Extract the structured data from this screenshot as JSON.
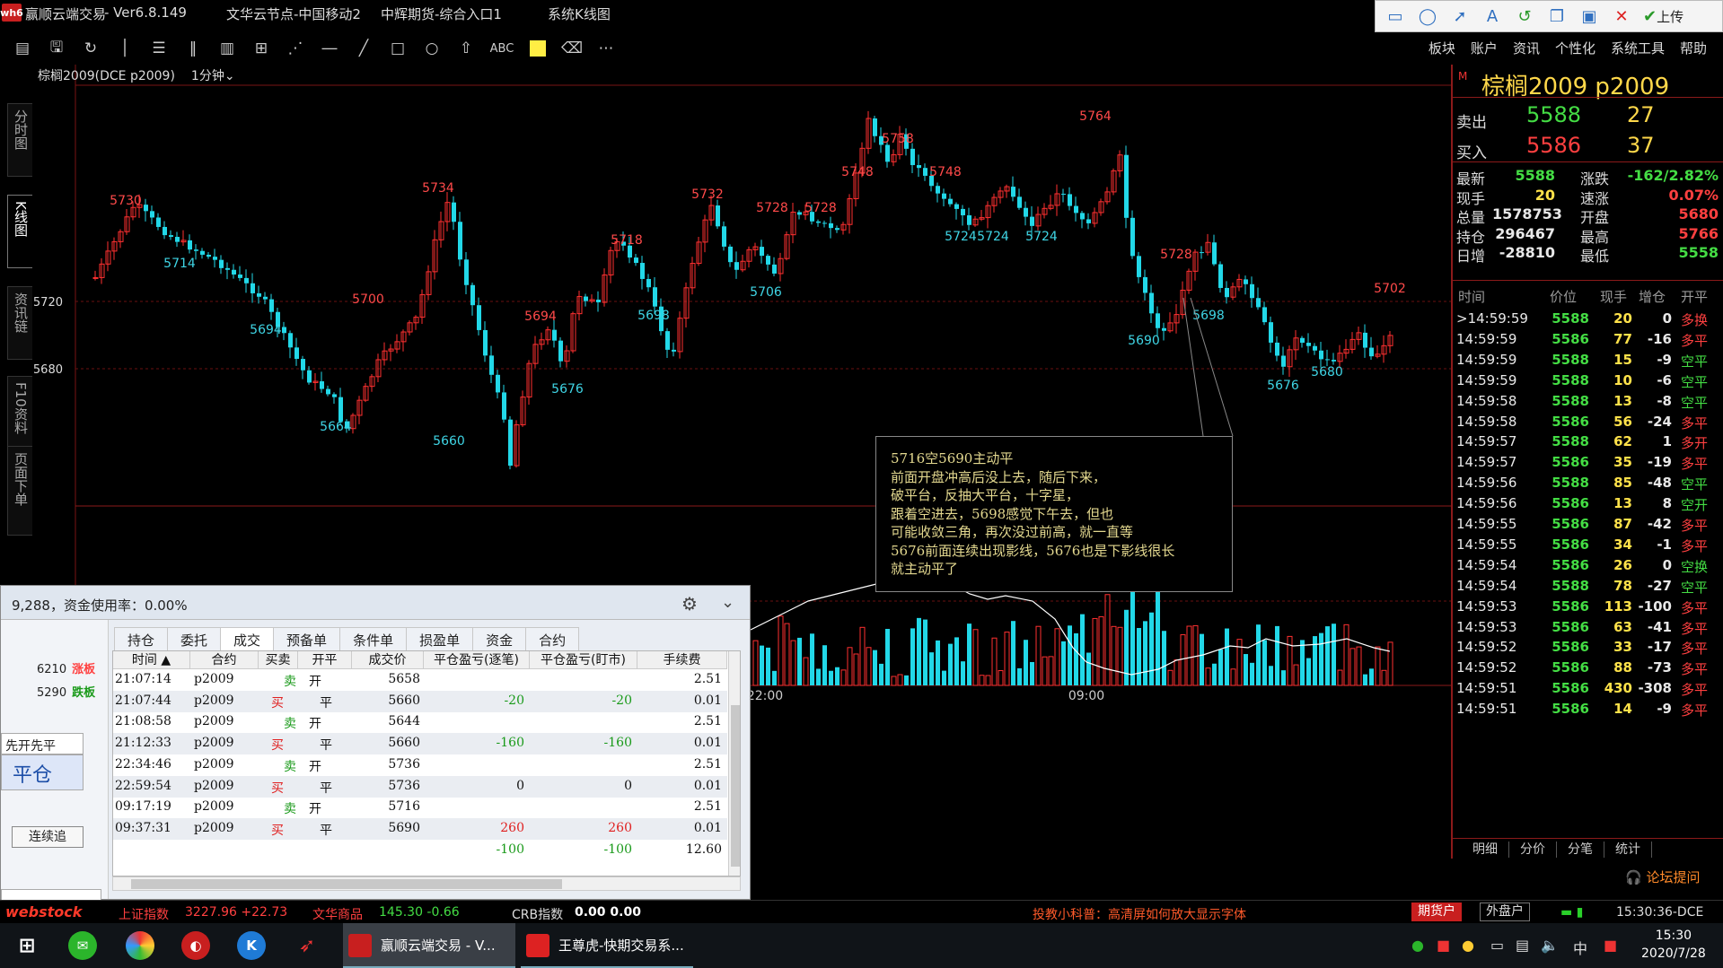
{
  "titlebar": {
    "app_name": "赢顺云端交易",
    "version": "- Ver6.8.149",
    "node": "文华云节点-中国移动2",
    "broker": "中辉期货-综合入口1",
    "window": "系统K线图",
    "upload_label": "上传"
  },
  "menus": [
    "板块",
    "账户",
    "资讯",
    "个性化",
    "系统工具",
    "帮助"
  ],
  "toolbar": {
    "abc_label": "ABC"
  },
  "left_tabs": [
    "分时图",
    "K线图",
    "资讯链",
    "F10资料",
    "页面下单"
  ],
  "chart": {
    "title": "棕榈2009(DCE p2009)",
    "period": "1分钟",
    "y_ticks": [
      "5720",
      "5680"
    ],
    "x_ticks": [
      "22:00",
      "09:00"
    ],
    "high_labels": [
      {
        "t": "5730"
      },
      {
        "t": "5734"
      },
      {
        "t": "5700"
      },
      {
        "t": "5694"
      },
      {
        "t": "5718"
      },
      {
        "t": "5732"
      },
      {
        "t": "5728"
      },
      {
        "t": "5728"
      },
      {
        "t": "5748"
      },
      {
        "t": "5758"
      },
      {
        "t": "5748"
      },
      {
        "t": "5764"
      },
      {
        "t": "5728"
      },
      {
        "t": "5702"
      }
    ],
    "low_labels": [
      {
        "t": "5714"
      },
      {
        "t": "5694"
      },
      {
        "t": "5664"
      },
      {
        "t": "5660"
      },
      {
        "t": "5676"
      },
      {
        "t": "5698"
      },
      {
        "t": "5706"
      },
      {
        "t": "5724"
      },
      {
        "t": "5724"
      },
      {
        "t": "5724"
      },
      {
        "t": "5690"
      },
      {
        "t": "5698"
      },
      {
        "t": "5676"
      },
      {
        "t": "5680"
      }
    ],
    "note_lines": [
      "5716空5690主动平",
      "前面开盘冲高后没上去，随后下来，",
      "破平台，反抽大平台，十字星，",
      "跟着空进去，5698感觉下午去，但也",
      "可能收敛三角，再次没过前高，就一直等",
      "5676前面连续出现影线，5676也是下影线很长",
      "就主动平了"
    ]
  },
  "quote": {
    "m": "M",
    "name": "棕榈2009  p2009",
    "ask_label": "卖出",
    "ask_price": "5588",
    "ask_vol": "27",
    "bid_label": "买入",
    "bid_price": "5586",
    "bid_vol": "37",
    "stats": [
      {
        "l": "最新",
        "v": "5588",
        "l2": "涨跌",
        "v2": "-162/2.82%"
      },
      {
        "l": "现手",
        "v": "20",
        "l2": "速涨",
        "v2": "0.07%"
      },
      {
        "l": "总量",
        "v": "1578753",
        "l2": "开盘",
        "v2": "5680"
      },
      {
        "l": "持仓",
        "v": "296467",
        "l2": "最高",
        "v2": "5766"
      },
      {
        "l": "日增",
        "v": "-28810",
        "l2": "最低",
        "v2": "5558"
      }
    ],
    "tick_headers": [
      "时间",
      "价位",
      "现手",
      "增仓",
      "开平"
    ],
    "ticks": [
      {
        "time": ">14:59:59",
        "price": "5588",
        "vol": "20",
        "oi": "0",
        "type": "多换"
      },
      {
        "time": "14:59:59",
        "price": "5586",
        "vol": "77",
        "oi": "-16",
        "type": "多平"
      },
      {
        "time": "14:59:59",
        "price": "5588",
        "vol": "15",
        "oi": "-9",
        "type": "空平"
      },
      {
        "time": "14:59:59",
        "price": "5588",
        "vol": "10",
        "oi": "-6",
        "type": "空平"
      },
      {
        "time": "14:59:58",
        "price": "5588",
        "vol": "13",
        "oi": "-8",
        "type": "空平"
      },
      {
        "time": "14:59:58",
        "price": "5586",
        "vol": "56",
        "oi": "-24",
        "type": "多平"
      },
      {
        "time": "14:59:57",
        "price": "5588",
        "vol": "62",
        "oi": "1",
        "type": "多开"
      },
      {
        "time": "14:59:57",
        "price": "5586",
        "vol": "35",
        "oi": "-19",
        "type": "多平"
      },
      {
        "time": "14:59:56",
        "price": "5588",
        "vol": "85",
        "oi": "-48",
        "type": "空平"
      },
      {
        "time": "14:59:56",
        "price": "5586",
        "vol": "13",
        "oi": "8",
        "type": "空开"
      },
      {
        "time": "14:59:55",
        "price": "5586",
        "vol": "87",
        "oi": "-42",
        "type": "多平"
      },
      {
        "time": "14:59:55",
        "price": "5586",
        "vol": "34",
        "oi": "-1",
        "type": "多平"
      },
      {
        "time": "14:59:54",
        "price": "5586",
        "vol": "26",
        "oi": "0",
        "type": "空换"
      },
      {
        "time": "14:59:54",
        "price": "5588",
        "vol": "78",
        "oi": "-27",
        "type": "空平"
      },
      {
        "time": "14:59:53",
        "price": "5586",
        "vol": "113",
        "oi": "-100",
        "type": "多平"
      },
      {
        "time": "14:59:53",
        "price": "5586",
        "vol": "63",
        "oi": "-41",
        "type": "多平"
      },
      {
        "time": "14:59:52",
        "price": "5586",
        "vol": "33",
        "oi": "-17",
        "type": "多平"
      },
      {
        "time": "14:59:52",
        "price": "5586",
        "vol": "88",
        "oi": "-73",
        "type": "多平"
      },
      {
        "time": "14:59:51",
        "price": "5586",
        "vol": "430",
        "oi": "-308",
        "type": "多平"
      },
      {
        "time": "14:59:51",
        "price": "5586",
        "vol": "14",
        "oi": "-9",
        "type": "多平"
      }
    ],
    "bottom_tabs": [
      "明细",
      "分价",
      "分笔",
      "统计"
    ],
    "forum": "论坛提问"
  },
  "trade": {
    "title": "9,288，资金使用率：0.00%",
    "limit_up_price": "6210",
    "limit_up_label": "涨板",
    "limit_down_price": "5290",
    "limit_down_label": "跌板",
    "kaiping": "先开先平",
    "pingcang": "平仓",
    "lianxu": "连续追",
    "tabs": [
      "持仓",
      "委托",
      "成交",
      "预备单",
      "条件单",
      "损盈单",
      "资金",
      "合约"
    ],
    "columns": [
      "时间 ▲",
      "合约",
      "买卖",
      "开平",
      "成交价",
      "平仓盈亏(逐笔)",
      "平仓盈亏(盯市)",
      "手续费"
    ],
    "rows": [
      {
        "time": "21:07:14",
        "contract": "p2009",
        "side": "卖",
        "oc": "开",
        "price": "5658",
        "pnl1": "",
        "pnl2": "",
        "fee": "2.51"
      },
      {
        "time": "21:07:44",
        "contract": "p2009",
        "side": "买",
        "oc": "平",
        "price": "5660",
        "pnl1": "-20",
        "pnl2": "-20",
        "fee": "0.01"
      },
      {
        "time": "21:08:58",
        "contract": "p2009",
        "side": "卖",
        "oc": "开",
        "price": "5644",
        "pnl1": "",
        "pnl2": "",
        "fee": "2.51"
      },
      {
        "time": "21:12:33",
        "contract": "p2009",
        "side": "买",
        "oc": "平",
        "price": "5660",
        "pnl1": "-160",
        "pnl2": "-160",
        "fee": "0.01"
      },
      {
        "time": "22:34:46",
        "contract": "p2009",
        "side": "卖",
        "oc": "开",
        "price": "5736",
        "pnl1": "",
        "pnl2": "",
        "fee": "2.51"
      },
      {
        "time": "22:59:54",
        "contract": "p2009",
        "side": "买",
        "oc": "平",
        "price": "5736",
        "pnl1": "0",
        "pnl2": "0",
        "fee": "0.01"
      },
      {
        "time": "09:17:19",
        "contract": "p2009",
        "side": "卖",
        "oc": "开",
        "price": "5716",
        "pnl1": "",
        "pnl2": "",
        "fee": "2.51"
      },
      {
        "time": "09:37:31",
        "contract": "p2009",
        "side": "买",
        "oc": "平",
        "price": "5690",
        "pnl1": "260",
        "pnl2": "260",
        "fee": "0.01"
      },
      {
        "time": "",
        "contract": "",
        "side": "",
        "oc": "",
        "price": "",
        "pnl1": "-100",
        "pnl2": "-100",
        "fee": "12.60"
      }
    ]
  },
  "ticker": {
    "brand": "webstock",
    "idx1_name": "上证指数",
    "idx1_val": "3227.96 +22.73",
    "idx2_name": "文华商品",
    "idx2_val": "145.30 -0.66",
    "idx3_name": "CRB指数",
    "idx3_val": "0.00 0.00",
    "tip": "投教小科普：高清屏如何放大显示字体",
    "btn1": "期货户",
    "btn2": "外盘户",
    "time": "15:30:36-DCE"
  },
  "taskbar": {
    "app1": "赢顺云端交易 - V...",
    "app2": "王尊虎-快期交易系...",
    "ime": "中",
    "clock_time": "15:30",
    "clock_date": "2020/7/28"
  }
}
